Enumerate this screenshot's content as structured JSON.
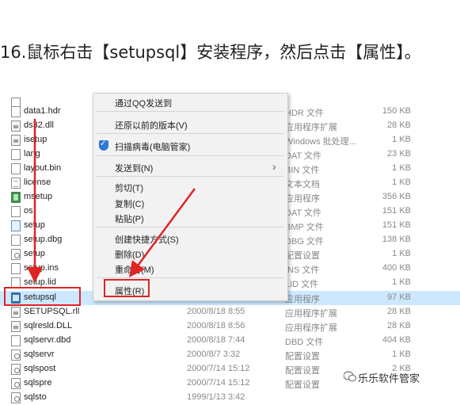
{
  "heading": "16.鼠标右击【setupsql】安装程序，然后点击【属性】。",
  "files": [
    {
      "name": "",
      "date": "",
      "type": "",
      "size": "",
      "icon": "doc-icon"
    },
    {
      "name": "data1.hdr",
      "date": "",
      "type": "HDR 文件",
      "size": "150 KB",
      "icon": "doc-icon"
    },
    {
      "name": "ds32.dll",
      "date": "",
      "type": "应用程序扩展",
      "size": "28 KB",
      "icon": "dll-icon"
    },
    {
      "name": "isetup",
      "date": "",
      "type": "Windows 批处理...",
      "size": "1 KB",
      "icon": "batch-icon"
    },
    {
      "name": "lang",
      "date": "",
      "type": "DAT 文件",
      "size": "23 KB",
      "icon": "doc-icon"
    },
    {
      "name": "layout.bin",
      "date": "",
      "type": "BIN 文件",
      "size": "1 KB",
      "icon": "doc-icon"
    },
    {
      "name": "license",
      "date": "",
      "type": "文本文档",
      "size": "1 KB",
      "icon": "text-icon"
    },
    {
      "name": "msetup",
      "date": "",
      "type": "应用程序",
      "size": "356 KB",
      "icon": "setup-app-icon"
    },
    {
      "name": "os",
      "date": "",
      "type": "DAT 文件",
      "size": "151 KB",
      "icon": "doc-icon"
    },
    {
      "name": "setup",
      "date": "",
      "type": "BMP 文件",
      "size": "151 KB",
      "icon": "image-icon"
    },
    {
      "name": "setup.dbg",
      "date": "",
      "type": "DBG 文件",
      "size": "138 KB",
      "icon": "doc-icon"
    },
    {
      "name": "setup",
      "date": "",
      "type": "配置设置",
      "size": "1 KB",
      "icon": "config-icon"
    },
    {
      "name": "setup.ins",
      "date": "",
      "type": "INS 文件",
      "size": "400 KB",
      "icon": "doc-icon"
    },
    {
      "name": "setup.lid",
      "date": "",
      "type": "LID 文件",
      "size": "1 KB",
      "icon": "doc-icon"
    },
    {
      "name": "setupsql",
      "date": "",
      "type": "应用程序",
      "size": "97 KB",
      "icon": "app-icon"
    },
    {
      "name": "SETUPSQL.rll",
      "date": "2000/8/18 8:55",
      "type": "应用程序扩展",
      "size": "28 KB",
      "icon": "dll-icon"
    },
    {
      "name": "sqlresld.DLL",
      "date": "2000/8/18 8:56",
      "type": "应用程序扩展",
      "size": "28 KB",
      "icon": "dll-icon"
    },
    {
      "name": "sqlservr.dbd",
      "date": "2000/8/18 7:44",
      "type": "DBD 文件",
      "size": "404 KB",
      "icon": "doc-icon"
    },
    {
      "name": "sqlservr",
      "date": "2000/8/7 3:32",
      "type": "配置设置",
      "size": "1 KB",
      "icon": "config-icon"
    },
    {
      "name": "sqlspost",
      "date": "2000/7/14 15:12",
      "type": "配置设置",
      "size": "2 KB",
      "icon": "config-icon"
    },
    {
      "name": "sqlspre",
      "date": "2000/7/14 15:12",
      "type": "配置设置",
      "size": "",
      "icon": "config-icon"
    },
    {
      "name": "sqlsto",
      "date": "1999/1/13 3:42",
      "type": "",
      "size": "",
      "icon": "config-icon"
    }
  ],
  "context_menu": {
    "items": [
      {
        "label": "通过QQ发送到"
      },
      {
        "label": "还原以前的版本(V)"
      },
      {
        "label": "扫描病毒(电脑管家)"
      },
      {
        "label": "发送到(N)"
      },
      {
        "label": "剪切(T)"
      },
      {
        "label": "复制(C)"
      },
      {
        "label": "粘贴(P)"
      },
      {
        "label": "创建快捷方式(S)"
      },
      {
        "label": "删除(D)"
      },
      {
        "label": "重命名(M)"
      },
      {
        "label": "属性(R)"
      }
    ],
    "submenu_arrow": "›"
  },
  "watermark": "乐乐软件管家",
  "colors": {
    "highlight_box": "#e02424",
    "selection": "#cce8ff",
    "menu_bg": "#f2f2f2"
  }
}
